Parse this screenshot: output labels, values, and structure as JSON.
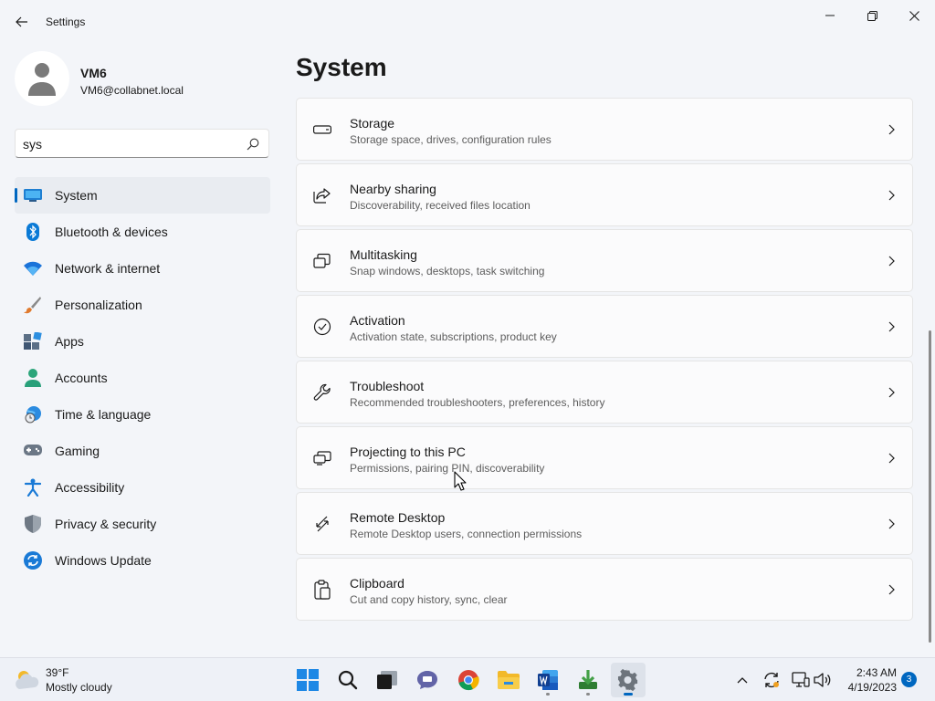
{
  "window": {
    "title": "Settings",
    "back_icon": "arrow-left-icon",
    "controls": [
      "minimize-icon",
      "maximize-icon",
      "close-icon"
    ]
  },
  "profile": {
    "name": "VM6",
    "email": "VM6@collabnet.local"
  },
  "search": {
    "value": "sys",
    "icon": "search-icon"
  },
  "sidebar": {
    "active_index": 0,
    "accent_color": "#0067c0",
    "items": [
      {
        "label": "System",
        "icon": "monitor-icon"
      },
      {
        "label": "Bluetooth & devices",
        "icon": "bluetooth-icon"
      },
      {
        "label": "Network & internet",
        "icon": "wifi-icon"
      },
      {
        "label": "Personalization",
        "icon": "brush-icon"
      },
      {
        "label": "Apps",
        "icon": "apps-icon"
      },
      {
        "label": "Accounts",
        "icon": "person-icon"
      },
      {
        "label": "Time & language",
        "icon": "globe-clock-icon"
      },
      {
        "label": "Gaming",
        "icon": "gamepad-icon"
      },
      {
        "label": "Accessibility",
        "icon": "accessibility-icon"
      },
      {
        "label": "Privacy & security",
        "icon": "shield-icon"
      },
      {
        "label": "Windows Update",
        "icon": "update-icon"
      }
    ]
  },
  "main": {
    "title": "System",
    "cards": [
      {
        "title": "Storage",
        "subtitle": "Storage space, drives, configuration rules",
        "icon": "storage-drive-icon"
      },
      {
        "title": "Nearby sharing",
        "subtitle": "Discoverability, received files location",
        "icon": "share-icon"
      },
      {
        "title": "Multitasking",
        "subtitle": "Snap windows, desktops, task switching",
        "icon": "multitasking-icon"
      },
      {
        "title": "Activation",
        "subtitle": "Activation state, subscriptions, product key",
        "icon": "check-circle-icon"
      },
      {
        "title": "Troubleshoot",
        "subtitle": "Recommended troubleshooters, preferences, history",
        "icon": "wrench-icon"
      },
      {
        "title": "Projecting to this PC",
        "subtitle": "Permissions, pairing PIN, discoverability",
        "icon": "projecting-icon"
      },
      {
        "title": "Remote Desktop",
        "subtitle": "Remote Desktop users, connection permissions",
        "icon": "remote-desktop-icon"
      },
      {
        "title": "Clipboard",
        "subtitle": "Cut and copy history, sync, clear",
        "icon": "clipboard-icon"
      }
    ]
  },
  "taskbar": {
    "weather": {
      "temp": "39°F",
      "desc": "Mostly cloudy",
      "icon": "partly-cloudy-icon"
    },
    "apps": [
      {
        "name": "start",
        "icon": "windows-logo-icon",
        "state": "none"
      },
      {
        "name": "search",
        "icon": "search-icon",
        "state": "none"
      },
      {
        "name": "task-view",
        "icon": "task-view-icon",
        "state": "none"
      },
      {
        "name": "chat",
        "icon": "chat-icon",
        "state": "none"
      },
      {
        "name": "chrome",
        "icon": "chrome-icon",
        "state": "none"
      },
      {
        "name": "file-explorer",
        "icon": "folder-icon",
        "state": "none"
      },
      {
        "name": "word",
        "icon": "word-icon",
        "state": "running"
      },
      {
        "name": "download",
        "icon": "download-icon",
        "state": "running"
      },
      {
        "name": "settings",
        "icon": "gear-icon",
        "state": "active"
      }
    ],
    "tray": [
      "chevron-up-icon",
      "sync-icon",
      "network-icon",
      "volume-icon"
    ],
    "clock": {
      "time": "2:43 AM",
      "date": "4/19/2023"
    },
    "notifications": "3"
  }
}
